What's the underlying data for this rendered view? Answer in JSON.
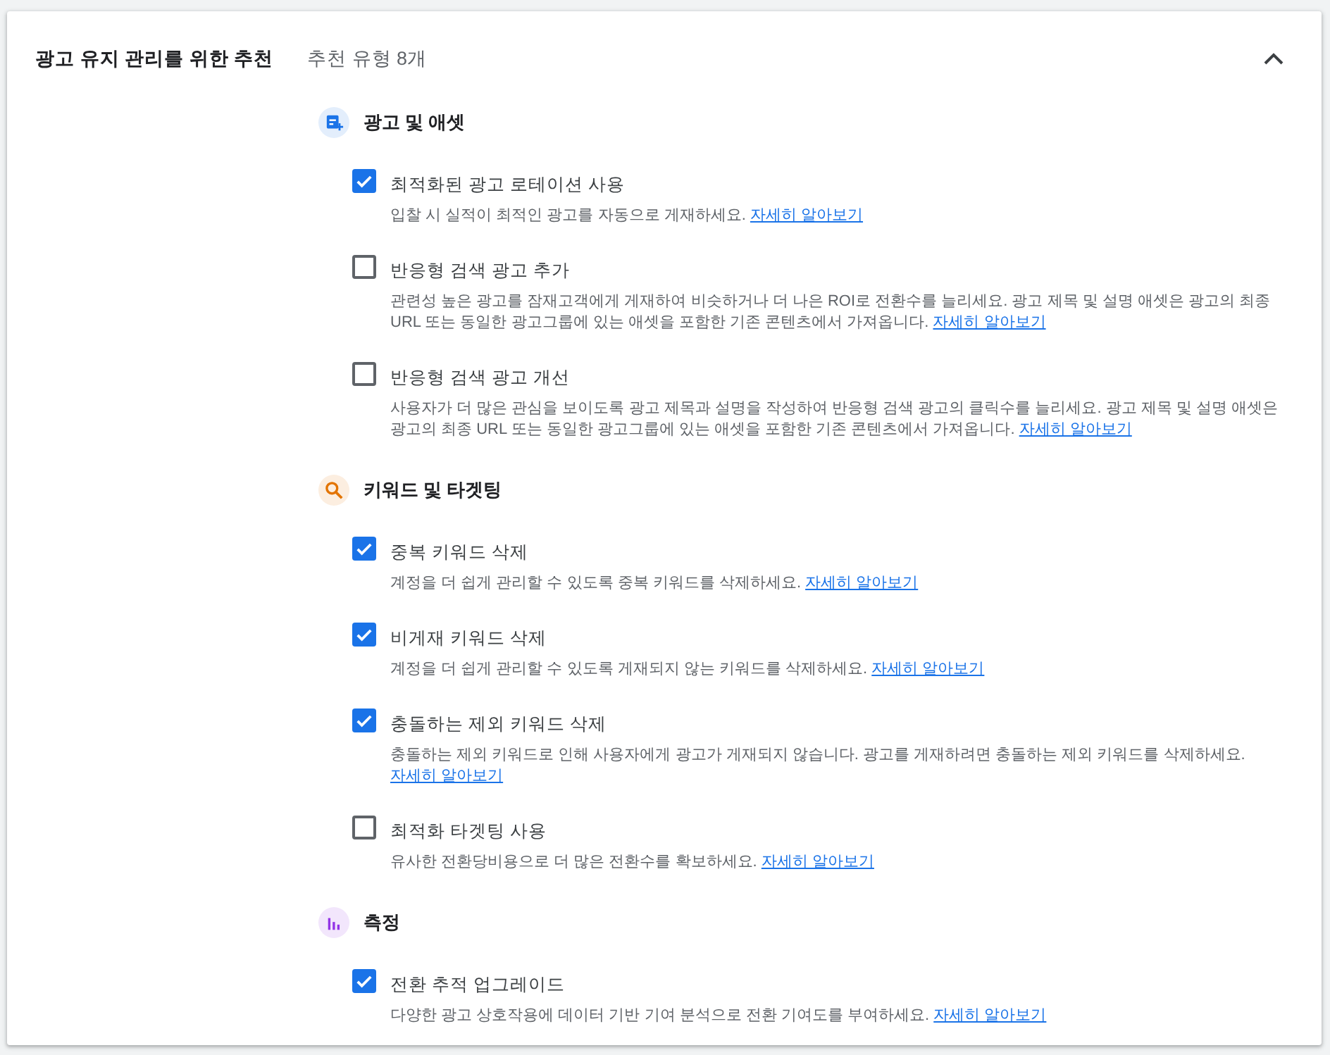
{
  "section": {
    "title": "광고 유지 관리를 위한 추천",
    "subtitle": "추천 유형 8개",
    "expanded": true
  },
  "groups": [
    {
      "heading": "광고 및 애셋",
      "kind": "ads",
      "color": "#1a73e8",
      "items": [
        {
          "label": "최적화된 광고 로테이션 사용",
          "checked": true,
          "description": "입찰 시 실적이 최적인 광고를 자동으로 게재하세요.",
          "link": "자세히 알아보기"
        },
        {
          "label": "반응형 검색 광고 추가",
          "checked": false,
          "description": "관련성 높은 광고를 잠재고객에게 게재하여 비슷하거나 더 나은 ROI로 전환수를 늘리세요. 광고 제목 및 설명 애셋은 광고의 최종 URL 또는 동일한 광고그룹에 있는 애셋을 포함한 기존 콘텐츠에서 가져옵니다.",
          "link": "자세히 알아보기"
        },
        {
          "label": "반응형 검색 광고 개선",
          "checked": false,
          "description": "사용자가 더 많은 관심을 보이도록 광고 제목과 설명을 작성하여 반응형 검색 광고의 클릭수를 늘리세요. 광고 제목 및 설명 애셋은 광고의 최종 URL 또는 동일한 광고그룹에 있는 애셋을 포함한 기존 콘텐츠에서 가져옵니다.",
          "link": "자세히 알아보기"
        }
      ]
    },
    {
      "heading": "키워드 및 타겟팅",
      "kind": "search",
      "color": "#e37400",
      "items": [
        {
          "label": "중복 키워드 삭제",
          "checked": true,
          "description": "계정을 더 쉽게 관리할 수 있도록 중복 키워드를 삭제하세요.",
          "link": "자세히 알아보기"
        },
        {
          "label": "비게재 키워드 삭제",
          "checked": true,
          "description": "계정을 더 쉽게 관리할 수 있도록 게재되지 않는 키워드를 삭제하세요.",
          "link": "자세히 알아보기"
        },
        {
          "label": "충돌하는 제외 키워드 삭제",
          "checked": true,
          "description": "충돌하는 제외 키워드로 인해 사용자에게 광고가 게재되지 않습니다. 광고를 게재하려면 충돌하는 제외 키워드를 삭제하세요.",
          "link": "자세히 알아보기"
        },
        {
          "label": "최적화 타겟팅 사용",
          "checked": false,
          "description": "유사한 전환당비용으로 더 많은 전환수를 확보하세요.",
          "link": "자세히 알아보기"
        }
      ]
    },
    {
      "heading": "측정",
      "kind": "chart",
      "color": "#9334e6",
      "items": [
        {
          "label": "전환 추적 업그레이드",
          "checked": true,
          "description": "다양한 광고 상호작용에 데이터 기반 기여 분석으로 전환 기여도를 부여하세요.",
          "link": "자세히 알아보기"
        }
      ]
    }
  ]
}
